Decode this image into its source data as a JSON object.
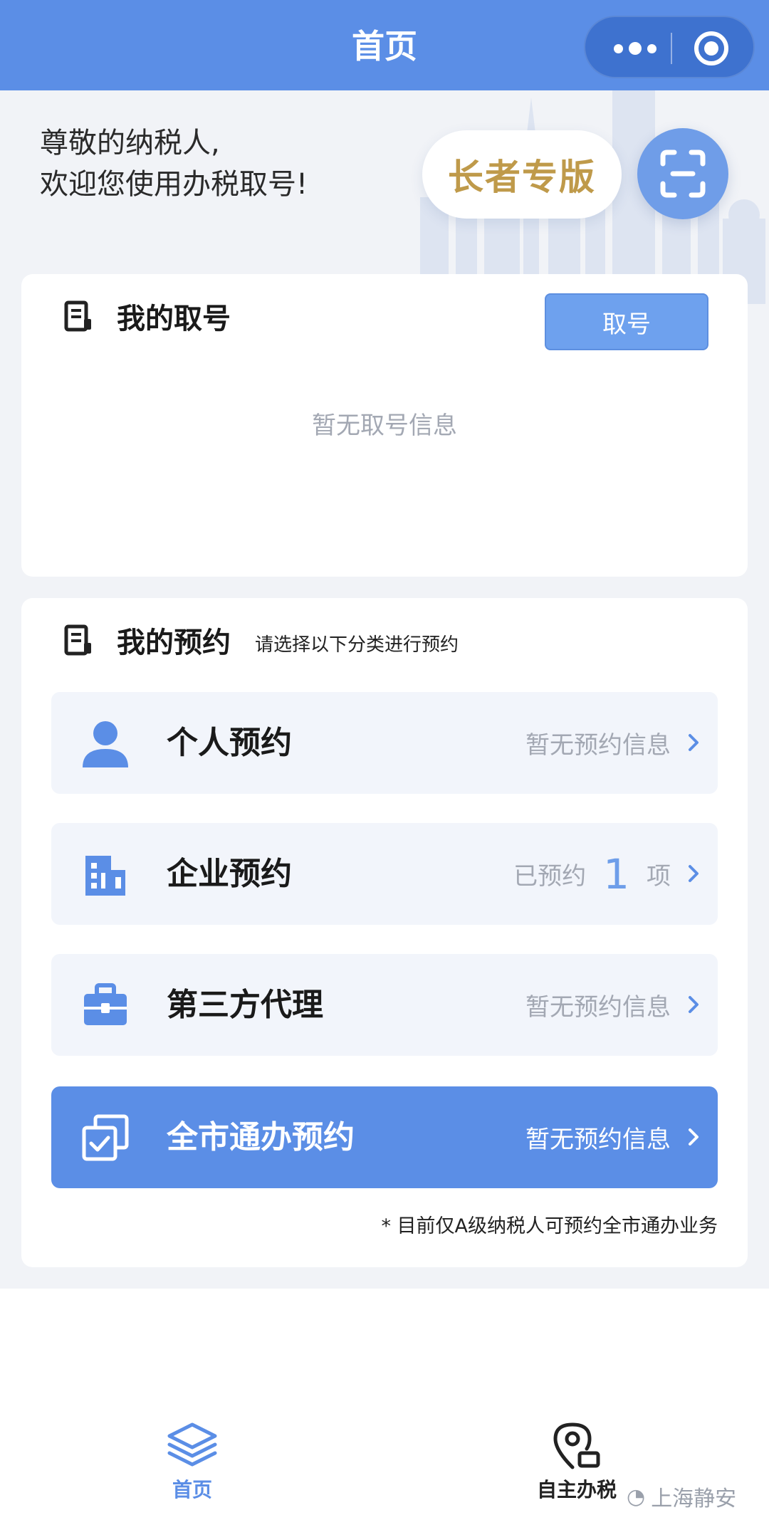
{
  "header": {
    "title": "首页",
    "more_icon": "more-dots-icon",
    "close_icon": "target-circle-icon"
  },
  "hero": {
    "greeting_line1": "尊敬的纳税人,",
    "greeting_line2": "欢迎您使用办税取号!",
    "elder_label": "长者专版",
    "scan_icon": "scan-icon"
  },
  "ticket": {
    "title": "我的取号",
    "take_button": "取号",
    "empty_text": "暂无取号信息"
  },
  "appointment": {
    "title": "我的预约",
    "subtitle": "请选择以下分类进行预约",
    "rows": [
      {
        "label": "个人预约",
        "status": "暂无预约信息",
        "icon": "person-icon"
      },
      {
        "label": "企业预约",
        "status_prefix": "已预约",
        "count": "1",
        "status_suffix": "项",
        "icon": "building-icon"
      },
      {
        "label": "第三方代理",
        "status": "暂无预约信息",
        "icon": "briefcase-icon"
      },
      {
        "label": "全市通办预约",
        "status": "暂无预约信息",
        "icon": "copy-check-icon"
      }
    ],
    "note": "* 目前仅A级纳税人可预约全市通办业务"
  },
  "tabbar": {
    "home_label": "首页",
    "self_label": "自主办税"
  },
  "watermark": "上海静安",
  "colors": {
    "primary": "#5b8ee6",
    "gold": "#bf9a4a",
    "muted": "#a3a8b3",
    "row_bg": "#f2f5fb"
  }
}
